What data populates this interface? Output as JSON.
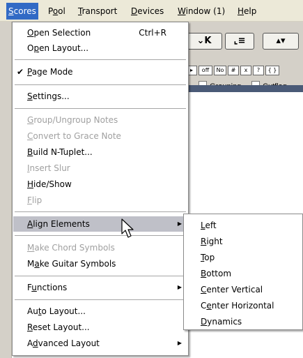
{
  "menubar": {
    "items": [
      {
        "pre": "",
        "ul": "S",
        "post": "cores"
      },
      {
        "pre": "P",
        "ul": "o",
        "post": "ol"
      },
      {
        "pre": "",
        "ul": "T",
        "post": "ransport"
      },
      {
        "pre": "",
        "ul": "D",
        "post": "evices"
      },
      {
        "pre": "",
        "ul": "W",
        "post": "indow (1)"
      },
      {
        "pre": "",
        "ul": "H",
        "post": "elp"
      }
    ]
  },
  "menu": {
    "items": [
      {
        "pre": "",
        "ul": "O",
        "post": "pen Selection",
        "shortcut": "Ctrl+R"
      },
      {
        "pre": "O",
        "ul": "p",
        "post": "en Layout..."
      },
      {
        "pre": "",
        "ul": "P",
        "post": "age Mode",
        "check": "✔"
      },
      {
        "pre": "",
        "ul": "S",
        "post": "ettings..."
      },
      {
        "pre": "",
        "ul": "G",
        "post": "roup/Ungroup Notes"
      },
      {
        "pre": "",
        "ul": "C",
        "post": "onvert to Grace Note"
      },
      {
        "pre": "",
        "ul": "B",
        "post": "uild N-Tuplet..."
      },
      {
        "pre": "",
        "ul": "I",
        "post": "nsert Slur"
      },
      {
        "pre": "",
        "ul": "H",
        "post": "ide/Show"
      },
      {
        "pre": "",
        "ul": "F",
        "post": "lip"
      },
      {
        "pre": "",
        "ul": "A",
        "post": "lign Elements"
      },
      {
        "pre": "",
        "ul": "M",
        "post": "ake Chord Symbols"
      },
      {
        "pre": "M",
        "ul": "a",
        "post": "ke Guitar Symbols"
      },
      {
        "pre": "F",
        "ul": "u",
        "post": "nctions"
      },
      {
        "pre": "Au",
        "ul": "t",
        "post": "o Layout..."
      },
      {
        "pre": "",
        "ul": "R",
        "post": "eset Layout..."
      },
      {
        "pre": "A",
        "ul": "d",
        "post": "vanced Layout"
      }
    ]
  },
  "submenu": {
    "items": [
      {
        "pre": "",
        "ul": "L",
        "post": "eft"
      },
      {
        "pre": "",
        "ul": "R",
        "post": "ight"
      },
      {
        "pre": "",
        "ul": "T",
        "post": "op"
      },
      {
        "pre": "",
        "ul": "B",
        "post": "ottom"
      },
      {
        "pre": "",
        "ul": "C",
        "post": "enter Vertical"
      },
      {
        "pre": "C",
        "ul": "e",
        "post": "nter Horizontal"
      },
      {
        "pre": "",
        "ul": "D",
        "post": "ynamics"
      }
    ]
  },
  "toolbar": {
    "btn_down_stop": "⌄K",
    "btn_insert": "⌞≡",
    "btn_updown": "▴▾",
    "small_buttons": [
      "▸",
      "off",
      "No",
      "#",
      "x",
      "?",
      "{ }"
    ],
    "chk_grouping": "Grouping",
    "chk_cutflag": "Cutflag"
  },
  "icons": {
    "submenu_arrow": "▶",
    "cursor": "mouse-pointer-icon"
  },
  "colors": {
    "menubar_bg": "#ece9d8",
    "active_menu": "#316ac5",
    "highlight": "#bfc0c8",
    "disabled_text": "#a0a0a0"
  }
}
